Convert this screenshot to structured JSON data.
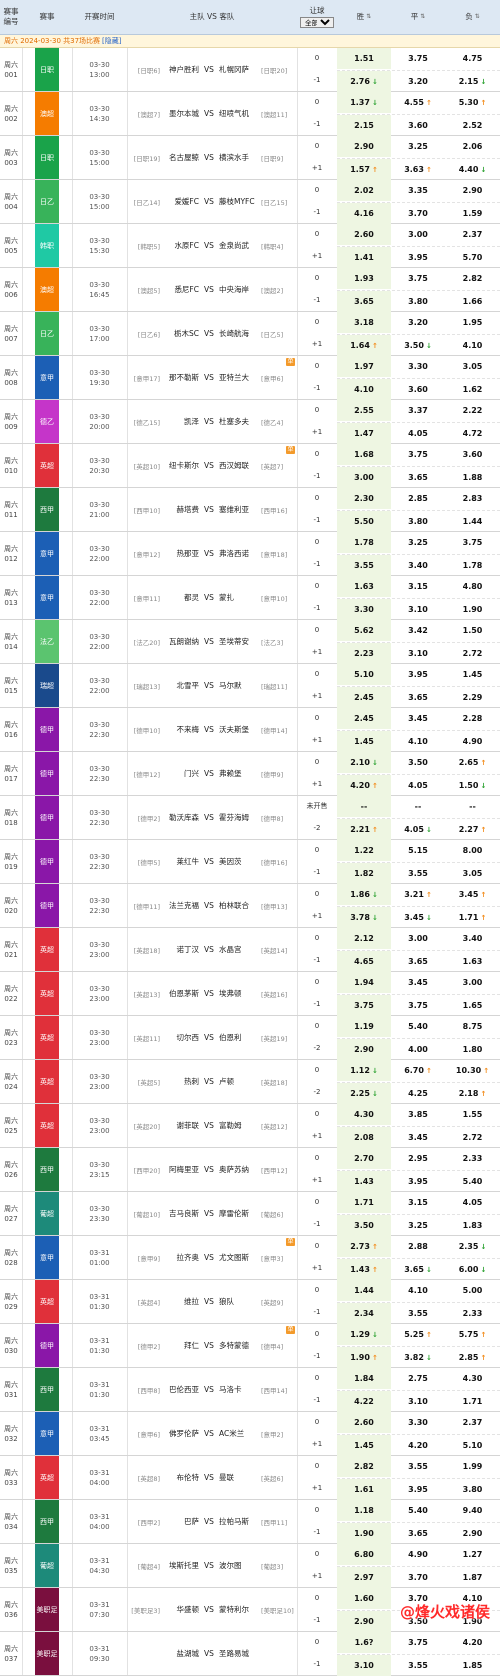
{
  "header": {
    "weekno": "赛事编号",
    "league": "赛事",
    "time": "开赛时间",
    "teams": "主队 VS 客队",
    "handicap": "让球",
    "handicap_filter": "全部",
    "win": "胜",
    "draw": "平",
    "loss": "负"
  },
  "notice": {
    "text": "周六 2024-03-30 共37场比赛",
    "hide": "[隐藏]"
  },
  "watermark": "@烽火戏诸侯",
  "matches": [
    {
      "no": "周六001",
      "lg": "日职",
      "lgc": "#1aa34a",
      "date": "03-30",
      "time": "13:00",
      "hrk": "[日职6]",
      "home": "神户胜利",
      "away": "札幌冈萨",
      "ark": "[日职20]",
      "flag": "",
      "h1": "0",
      "h2": "-1",
      "o1": [
        "1.51",
        "",
        "3.75",
        "",
        "4.75",
        ""
      ],
      "o2": [
        "2.76",
        "dn",
        "3.20",
        "",
        "2.15",
        "dn"
      ]
    },
    {
      "no": "周六002",
      "lg": "澳超",
      "lgc": "#f57c00",
      "date": "03-30",
      "time": "14:30",
      "hrk": "[澳超7]",
      "home": "墨尔本城",
      "away": "纽喷气机",
      "ark": "[澳超11]",
      "flag": "",
      "h1": "0",
      "h2": "-1",
      "o1": [
        "1.37",
        "dn",
        "4.55",
        "up",
        "5.30",
        "up"
      ],
      "o2": [
        "2.15",
        "",
        "3.60",
        "",
        "2.52",
        ""
      ]
    },
    {
      "no": "周六003",
      "lg": "日职",
      "lgc": "#1aa34a",
      "date": "03-30",
      "time": "15:00",
      "hrk": "[日职19]",
      "home": "名古屋鲸",
      "away": "横滨水手",
      "ark": "[日职9]",
      "flag": "",
      "h1": "0",
      "h2": "+1",
      "o1": [
        "2.90",
        "",
        "3.25",
        "",
        "2.06",
        ""
      ],
      "o2": [
        "1.57",
        "up",
        "3.63",
        "up",
        "4.40",
        "dn"
      ]
    },
    {
      "no": "周六004",
      "lg": "日乙",
      "lgc": "#38b35a",
      "date": "03-30",
      "time": "15:00",
      "hrk": "[日乙14]",
      "home": "爱媛FC",
      "away": "藤枝MYFC",
      "ark": "[日乙15]",
      "flag": "",
      "h1": "0",
      "h2": "-1",
      "o1": [
        "2.02",
        "",
        "3.35",
        "",
        "2.90",
        ""
      ],
      "o2": [
        "4.16",
        "",
        "3.70",
        "",
        "1.59",
        ""
      ]
    },
    {
      "no": "周六005",
      "lg": "韩职",
      "lgc": "#1fc9a4",
      "date": "03-30",
      "time": "15:30",
      "hrk": "[韩职5]",
      "home": "水原FC",
      "away": "金泉尚武",
      "ark": "[韩职4]",
      "flag": "",
      "h1": "0",
      "h2": "+1",
      "o1": [
        "2.60",
        "",
        "3.00",
        "",
        "2.37",
        ""
      ],
      "o2": [
        "1.41",
        "",
        "3.95",
        "",
        "5.70",
        ""
      ]
    },
    {
      "no": "周六006",
      "lg": "澳超",
      "lgc": "#f57c00",
      "date": "03-30",
      "time": "16:45",
      "hrk": "[澳超5]",
      "home": "悉尼FC",
      "away": "中央海岸",
      "ark": "[澳超2]",
      "flag": "",
      "h1": "0",
      "h2": "-1",
      "o1": [
        "1.93",
        "",
        "3.75",
        "",
        "2.82",
        ""
      ],
      "o2": [
        "3.65",
        "",
        "3.80",
        "",
        "1.66",
        ""
      ]
    },
    {
      "no": "周六007",
      "lg": "日乙",
      "lgc": "#38b35a",
      "date": "03-30",
      "time": "17:00",
      "hrk": "[日乙6]",
      "home": "栃木SC",
      "away": "长崎航海",
      "ark": "[日乙5]",
      "flag": "",
      "h1": "0",
      "h2": "+1",
      "o1": [
        "3.18",
        "",
        "3.20",
        "",
        "1.95",
        ""
      ],
      "o2": [
        "1.64",
        "up",
        "3.50",
        "dn",
        "4.10",
        ""
      ]
    },
    {
      "no": "周六008",
      "lg": "意甲",
      "lgc": "#1c5fb5",
      "date": "03-30",
      "time": "19:30",
      "hrk": "[意甲17]",
      "home": "那不勒斯",
      "away": "亚特兰大",
      "ark": "[意甲6]",
      "flag": "单",
      "h1": "0",
      "h2": "-1",
      "o1": [
        "1.97",
        "",
        "3.30",
        "",
        "3.05",
        ""
      ],
      "o2": [
        "4.10",
        "",
        "3.60",
        "",
        "1.62",
        ""
      ]
    },
    {
      "no": "周六009",
      "lg": "德乙",
      "lgc": "#c535c9",
      "date": "03-30",
      "time": "20:00",
      "hrk": "[德乙15]",
      "home": "凯泽",
      "away": "杜塞多夫",
      "ark": "[德乙4]",
      "flag": "",
      "h1": "0",
      "h2": "+1",
      "o1": [
        "2.55",
        "",
        "3.37",
        "",
        "2.22",
        ""
      ],
      "o2": [
        "1.47",
        "",
        "4.05",
        "",
        "4.72",
        ""
      ]
    },
    {
      "no": "周六010",
      "lg": "英超",
      "lgc": "#e0303a",
      "date": "03-30",
      "time": "20:30",
      "hrk": "[英超10]",
      "home": "纽卡斯尔",
      "away": "西汉姆联",
      "ark": "[英超7]",
      "flag": "单",
      "h1": "0",
      "h2": "-1",
      "o1": [
        "1.68",
        "",
        "3.75",
        "",
        "3.60",
        ""
      ],
      "o2": [
        "3.00",
        "",
        "3.65",
        "",
        "1.88",
        ""
      ]
    },
    {
      "no": "周六011",
      "lg": "西甲",
      "lgc": "#1e7a3e",
      "date": "03-30",
      "time": "21:00",
      "hrk": "[西甲10]",
      "home": "赫塔费",
      "away": "塞维利亚",
      "ark": "[西甲16]",
      "flag": "",
      "h1": "0",
      "h2": "-1",
      "o1": [
        "2.30",
        "",
        "2.85",
        "",
        "2.83",
        ""
      ],
      "o2": [
        "5.50",
        "",
        "3.80",
        "",
        "1.44",
        ""
      ]
    },
    {
      "no": "周六012",
      "lg": "意甲",
      "lgc": "#1c5fb5",
      "date": "03-30",
      "time": "22:00",
      "hrk": "[意甲12]",
      "home": "热那亚",
      "away": "弗洛西诺",
      "ark": "[意甲18]",
      "flag": "",
      "h1": "0",
      "h2": "-1",
      "o1": [
        "1.78",
        "",
        "3.25",
        "",
        "3.75",
        ""
      ],
      "o2": [
        "3.55",
        "",
        "3.40",
        "",
        "1.78",
        ""
      ]
    },
    {
      "no": "周六013",
      "lg": "意甲",
      "lgc": "#1c5fb5",
      "date": "03-30",
      "time": "22:00",
      "hrk": "[意甲11]",
      "home": "都灵",
      "away": "蒙扎",
      "ark": "[意甲10]",
      "flag": "",
      "h1": "0",
      "h2": "-1",
      "o1": [
        "1.63",
        "",
        "3.15",
        "",
        "4.80",
        ""
      ],
      "o2": [
        "3.30",
        "",
        "3.10",
        "",
        "1.90",
        ""
      ]
    },
    {
      "no": "周六014",
      "lg": "法乙",
      "lgc": "#5bc46f",
      "date": "03-30",
      "time": "22:00",
      "hrk": "[法乙20]",
      "home": "瓦朗谢纳",
      "away": "圣埃蒂安",
      "ark": "[法乙3]",
      "flag": "",
      "h1": "0",
      "h2": "+1",
      "o1": [
        "5.62",
        "",
        "3.42",
        "",
        "1.50",
        ""
      ],
      "o2": [
        "2.23",
        "",
        "3.10",
        "",
        "2.72",
        ""
      ]
    },
    {
      "no": "周六015",
      "lg": "瑞超",
      "lgc": "#1a4a8c",
      "date": "03-30",
      "time": "22:00",
      "hrk": "[瑞超13]",
      "home": "北雪平",
      "away": "马尔默",
      "ark": "[瑞超11]",
      "flag": "",
      "h1": "0",
      "h2": "+1",
      "o1": [
        "5.10",
        "",
        "3.95",
        "",
        "1.45",
        ""
      ],
      "o2": [
        "2.45",
        "",
        "3.65",
        "",
        "2.29",
        ""
      ]
    },
    {
      "no": "周六016",
      "lg": "德甲",
      "lgc": "#8a17a8",
      "date": "03-30",
      "time": "22:30",
      "hrk": "[德甲10]",
      "home": "不来梅",
      "away": "沃夫斯堡",
      "ark": "[德甲14]",
      "flag": "",
      "h1": "0",
      "h2": "+1",
      "o1": [
        "2.45",
        "",
        "3.45",
        "",
        "2.28",
        ""
      ],
      "o2": [
        "1.45",
        "",
        "4.10",
        "",
        "4.90",
        ""
      ]
    },
    {
      "no": "周六017",
      "lg": "德甲",
      "lgc": "#8a17a8",
      "date": "03-30",
      "time": "22:30",
      "hrk": "[德甲12]",
      "home": "门兴",
      "away": "弗赖堡",
      "ark": "[德甲9]",
      "flag": "",
      "h1": "0",
      "h2": "+1",
      "o1": [
        "2.10",
        "dn",
        "3.50",
        "",
        "2.65",
        "up"
      ],
      "o2": [
        "4.20",
        "up",
        "4.05",
        "",
        "1.50",
        "dn"
      ]
    },
    {
      "no": "周六018",
      "lg": "德甲",
      "lgc": "#8a17a8",
      "date": "03-30",
      "time": "22:30",
      "hrk": "[德甲2]",
      "home": "勒沃库森",
      "away": "霍芬海姆",
      "ark": "[德甲8]",
      "flag": "",
      "h1": "未开售",
      "h2": "-2",
      "o1": [
        "--",
        "",
        "--",
        "",
        "--",
        ""
      ],
      "o2": [
        "2.21",
        "up",
        "4.05",
        "dn",
        "2.27",
        "up"
      ]
    },
    {
      "no": "周六019",
      "lg": "德甲",
      "lgc": "#8a17a8",
      "date": "03-30",
      "time": "22:30",
      "hrk": "[德甲5]",
      "home": "莱红牛",
      "away": "美因茨",
      "ark": "[德甲16]",
      "flag": "",
      "h1": "0",
      "h2": "-1",
      "o1": [
        "1.22",
        "",
        "5.15",
        "",
        "8.00",
        ""
      ],
      "o2": [
        "1.82",
        "",
        "3.55",
        "",
        "3.05",
        ""
      ]
    },
    {
      "no": "周六020",
      "lg": "德甲",
      "lgc": "#8a17a8",
      "date": "03-30",
      "time": "22:30",
      "hrk": "[德甲11]",
      "home": "法兰克福",
      "away": "柏林联合",
      "ark": "[德甲13]",
      "flag": "",
      "h1": "0",
      "h2": "+1",
      "o1": [
        "1.86",
        "dn",
        "3.21",
        "up",
        "3.45",
        "up"
      ],
      "o2": [
        "3.78",
        "dn",
        "3.45",
        "dn",
        "1.71",
        "up"
      ]
    },
    {
      "no": "周六021",
      "lg": "英超",
      "lgc": "#e0303a",
      "date": "03-30",
      "time": "23:00",
      "hrk": "[英超18]",
      "home": "诺丁汉",
      "away": "水晶宫",
      "ark": "[英超14]",
      "flag": "",
      "h1": "0",
      "h2": "-1",
      "o1": [
        "2.12",
        "",
        "3.00",
        "",
        "3.40",
        ""
      ],
      "o2": [
        "4.65",
        "",
        "3.65",
        "",
        "1.63",
        ""
      ]
    },
    {
      "no": "周六022",
      "lg": "英超",
      "lgc": "#e0303a",
      "date": "03-30",
      "time": "23:00",
      "hrk": "[英超13]",
      "home": "伯恩茅斯",
      "away": "埃弗顿",
      "ark": "[英超16]",
      "flag": "",
      "h1": "0",
      "h2": "-1",
      "o1": [
        "1.94",
        "",
        "3.45",
        "",
        "3.00",
        ""
      ],
      "o2": [
        "3.75",
        "",
        "3.75",
        "",
        "1.65",
        ""
      ]
    },
    {
      "no": "周六023",
      "lg": "英超",
      "lgc": "#e0303a",
      "date": "03-30",
      "time": "23:00",
      "hrk": "[英超11]",
      "home": "切尔西",
      "away": "伯恩利",
      "ark": "[英超19]",
      "flag": "",
      "h1": "0",
      "h2": "-2",
      "o1": [
        "1.19",
        "",
        "5.40",
        "",
        "8.75",
        ""
      ],
      "o2": [
        "2.90",
        "",
        "4.00",
        "",
        "1.80",
        ""
      ]
    },
    {
      "no": "周六024",
      "lg": "英超",
      "lgc": "#e0303a",
      "date": "03-30",
      "time": "23:00",
      "hrk": "[英超5]",
      "home": "热刺",
      "away": "卢顿",
      "ark": "[英超18]",
      "flag": "",
      "h1": "0",
      "h2": "-2",
      "o1": [
        "1.12",
        "dn",
        "6.70",
        "up",
        "10.30",
        "up"
      ],
      "o2": [
        "2.25",
        "dn",
        "4.25",
        "",
        "2.18",
        "up"
      ]
    },
    {
      "no": "周六025",
      "lg": "英超",
      "lgc": "#e0303a",
      "date": "03-30",
      "time": "23:00",
      "hrk": "[英超20]",
      "home": "谢菲联",
      "away": "富勒姆",
      "ark": "[英超12]",
      "flag": "",
      "h1": "0",
      "h2": "+1",
      "o1": [
        "4.30",
        "",
        "3.85",
        "",
        "1.55",
        ""
      ],
      "o2": [
        "2.08",
        "",
        "3.45",
        "",
        "2.72",
        ""
      ]
    },
    {
      "no": "周六026",
      "lg": "西甲",
      "lgc": "#1e7a3e",
      "date": "03-30",
      "time": "23:15",
      "hrk": "[西甲20]",
      "home": "阿梅里亚",
      "away": "奥萨苏纳",
      "ark": "[西甲12]",
      "flag": "",
      "h1": "0",
      "h2": "+1",
      "o1": [
        "2.70",
        "",
        "2.95",
        "",
        "2.33",
        ""
      ],
      "o2": [
        "1.43",
        "",
        "3.95",
        "",
        "5.40",
        ""
      ]
    },
    {
      "no": "周六027",
      "lg": "葡超",
      "lgc": "#1d8a7a",
      "date": "03-30",
      "time": "23:30",
      "hrk": "[葡超10]",
      "home": "吉马良斯",
      "away": "摩雷伦斯",
      "ark": "[葡超6]",
      "flag": "",
      "h1": "0",
      "h2": "-1",
      "o1": [
        "1.71",
        "",
        "3.15",
        "",
        "4.05",
        ""
      ],
      "o2": [
        "3.50",
        "",
        "3.25",
        "",
        "1.83",
        ""
      ]
    },
    {
      "no": "周六028",
      "lg": "意甲",
      "lgc": "#1c5fb5",
      "date": "03-31",
      "time": "01:00",
      "hrk": "[意甲9]",
      "home": "拉齐奥",
      "away": "尤文图斯",
      "ark": "[意甲3]",
      "flag": "单",
      "h1": "0",
      "h2": "+1",
      "o1": [
        "2.73",
        "up",
        "2.88",
        "",
        "2.35",
        "dn"
      ],
      "o2": [
        "1.43",
        "up",
        "3.65",
        "dn",
        "6.00",
        "dn"
      ]
    },
    {
      "no": "周六029",
      "lg": "英超",
      "lgc": "#e0303a",
      "date": "03-31",
      "time": "01:30",
      "hrk": "[英超4]",
      "home": "维拉",
      "away": "狼队",
      "ark": "[英超9]",
      "flag": "",
      "h1": "0",
      "h2": "-1",
      "o1": [
        "1.44",
        "",
        "4.10",
        "",
        "5.00",
        ""
      ],
      "o2": [
        "2.34",
        "",
        "3.55",
        "",
        "2.33",
        ""
      ]
    },
    {
      "no": "周六030",
      "lg": "德甲",
      "lgc": "#8a17a8",
      "date": "03-31",
      "time": "01:30",
      "hrk": "[德甲2]",
      "home": "拜仁",
      "away": "多特蒙德",
      "ark": "[德甲4]",
      "flag": "单",
      "h1": "0",
      "h2": "-1",
      "o1": [
        "1.29",
        "dn",
        "5.25",
        "up",
        "5.75",
        "up"
      ],
      "o2": [
        "1.90",
        "up",
        "3.82",
        "dn",
        "2.85",
        "up"
      ]
    },
    {
      "no": "周六031",
      "lg": "西甲",
      "lgc": "#1e7a3e",
      "date": "03-31",
      "time": "01:30",
      "hrk": "[西甲8]",
      "home": "巴伦西亚",
      "away": "马洛卡",
      "ark": "[西甲14]",
      "flag": "",
      "h1": "0",
      "h2": "-1",
      "o1": [
        "1.84",
        "",
        "2.75",
        "",
        "4.30",
        ""
      ],
      "o2": [
        "4.22",
        "",
        "3.10",
        "",
        "1.71",
        ""
      ]
    },
    {
      "no": "周六032",
      "lg": "意甲",
      "lgc": "#1c5fb5",
      "date": "03-31",
      "time": "03:45",
      "hrk": "[意甲6]",
      "home": "佛罗伦萨",
      "away": "AC米兰",
      "ark": "[意甲2]",
      "flag": "",
      "h1": "0",
      "h2": "+1",
      "o1": [
        "2.60",
        "",
        "3.30",
        "",
        "2.37",
        ""
      ],
      "o2": [
        "1.45",
        "",
        "4.20",
        "",
        "5.10",
        ""
      ]
    },
    {
      "no": "周六033",
      "lg": "英超",
      "lgc": "#e0303a",
      "date": "03-31",
      "time": "04:00",
      "hrk": "[英超8]",
      "home": "布伦特",
      "away": "曼联",
      "ark": "[英超6]",
      "flag": "",
      "h1": "0",
      "h2": "+1",
      "o1": [
        "2.82",
        "",
        "3.55",
        "",
        "1.99",
        ""
      ],
      "o2": [
        "1.61",
        "",
        "3.95",
        "",
        "3.80",
        ""
      ]
    },
    {
      "no": "周六034",
      "lg": "西甲",
      "lgc": "#1e7a3e",
      "date": "03-31",
      "time": "04:00",
      "hrk": "[西甲2]",
      "home": "巴萨",
      "away": "拉帕马斯",
      "ark": "[西甲11]",
      "flag": "",
      "h1": "0",
      "h2": "-1",
      "o1": [
        "1.18",
        "",
        "5.40",
        "",
        "9.40",
        ""
      ],
      "o2": [
        "1.90",
        "",
        "3.65",
        "",
        "2.90",
        ""
      ]
    },
    {
      "no": "周六035",
      "lg": "葡超",
      "lgc": "#1d8a7a",
      "date": "03-31",
      "time": "04:30",
      "hrk": "[葡超4]",
      "home": "埃斯托里",
      "away": "波尔图",
      "ark": "[葡超3]",
      "flag": "",
      "h1": "0",
      "h2": "+1",
      "o1": [
        "6.80",
        "",
        "4.90",
        "",
        "1.27",
        ""
      ],
      "o2": [
        "2.97",
        "",
        "3.70",
        "",
        "1.87",
        ""
      ]
    },
    {
      "no": "周六036",
      "lg": "美职足",
      "lgc": "#7a0f3e",
      "date": "03-31",
      "time": "07:30",
      "hrk": "[美职足3]",
      "home": "华盛顿",
      "away": "蒙特利尔",
      "ark": "[美职足10]",
      "flag": "",
      "h1": "0",
      "h2": "-1",
      "o1": [
        "1.60",
        "",
        "3.70",
        "",
        "4.10",
        ""
      ],
      "o2": [
        "2.90",
        "",
        "3.50",
        "",
        "1.90",
        ""
      ]
    },
    {
      "no": "周六037",
      "lg": "美职足",
      "lgc": "#7a0f3e",
      "date": "03-31",
      "time": "09:30",
      "hrk": "",
      "home": "盐湖城",
      "away": "圣路易城",
      "ark": "",
      "flag": "",
      "h1": "0",
      "h2": "-1",
      "o1": [
        "1.6?",
        "",
        "3.75",
        "",
        "4.20",
        ""
      ],
      "o2": [
        "3.10",
        "",
        "3.55",
        "",
        "1.85",
        ""
      ]
    }
  ]
}
